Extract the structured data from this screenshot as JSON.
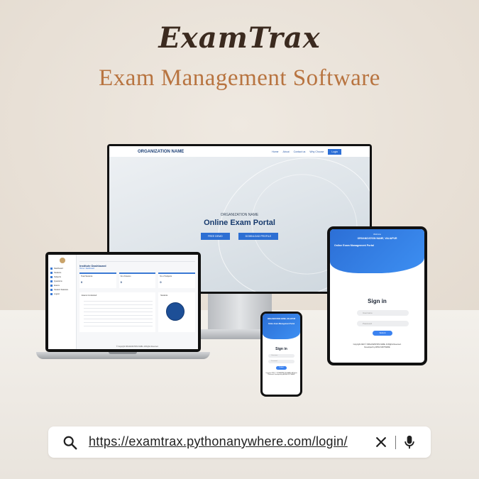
{
  "header": {
    "brand": "ExamTrax",
    "tagline": "Exam Management Software"
  },
  "monitor": {
    "org_name": "ORGANIZATION NAME",
    "nav_links": [
      "Home",
      "About",
      "Contact us",
      "Why Choose"
    ],
    "login_label": "Login",
    "hero_sub": "ORGANIZATION NAME",
    "hero_title": "Online Exam Portal",
    "buttons": [
      "FREE DEMO",
      "DOWNLOAD PROFILE"
    ]
  },
  "laptop": {
    "menu": [
      "Dashboard",
      "Students",
      "Subjects",
      "Questions",
      "Exams",
      "Student Statistics",
      "Logout"
    ],
    "title": "Institute Dashboard",
    "crumb": "Home / Dashboard",
    "cards": [
      {
        "label": "Total Students",
        "value": "0"
      },
      {
        "label": "No of Exams",
        "value": "0"
      },
      {
        "label": "No of Subjects",
        "value": "0"
      }
    ],
    "chart_title": "Exams Conducted",
    "pie_title": "Students",
    "footer": "© Copyright ORGANIZATION NAME. All Rights Reserved."
  },
  "tablet": {
    "welcome": "Welcome",
    "org": "ORGANIZATION NAME, VALIAPUR",
    "system": "Online Exam Management Portal",
    "sign_in": "Sign in",
    "username_placeholder": "Username",
    "password_placeholder": "Password",
    "submit": "Submit",
    "copyright": "Copyright 2022 © ORGANIZATION NAME. All Rights Reserved.",
    "developer": "Developed by ARIVA SOFTWARE"
  },
  "phone": {
    "org": "ORGANIZATION NAME, VALIAPUR",
    "system": "Online Exam Management Portal",
    "sign_in": "Sign in",
    "username_placeholder": "Username",
    "password_placeholder": "Password",
    "submit": "Submit",
    "copyright": "Copyright 2022 © ORGANIZATION NAME. All Rights Reserved. Developed by ARIVA SOFTWARE"
  },
  "search": {
    "url": "https://examtrax.pythonanywhere.com/login/",
    "search_icon": "search-icon",
    "clear_icon": "close-icon",
    "mic_icon": "microphone-icon"
  },
  "colors": {
    "brand": "#3b2a1f",
    "tagline": "#b87440",
    "primary_blue": "#2c6fd6"
  }
}
